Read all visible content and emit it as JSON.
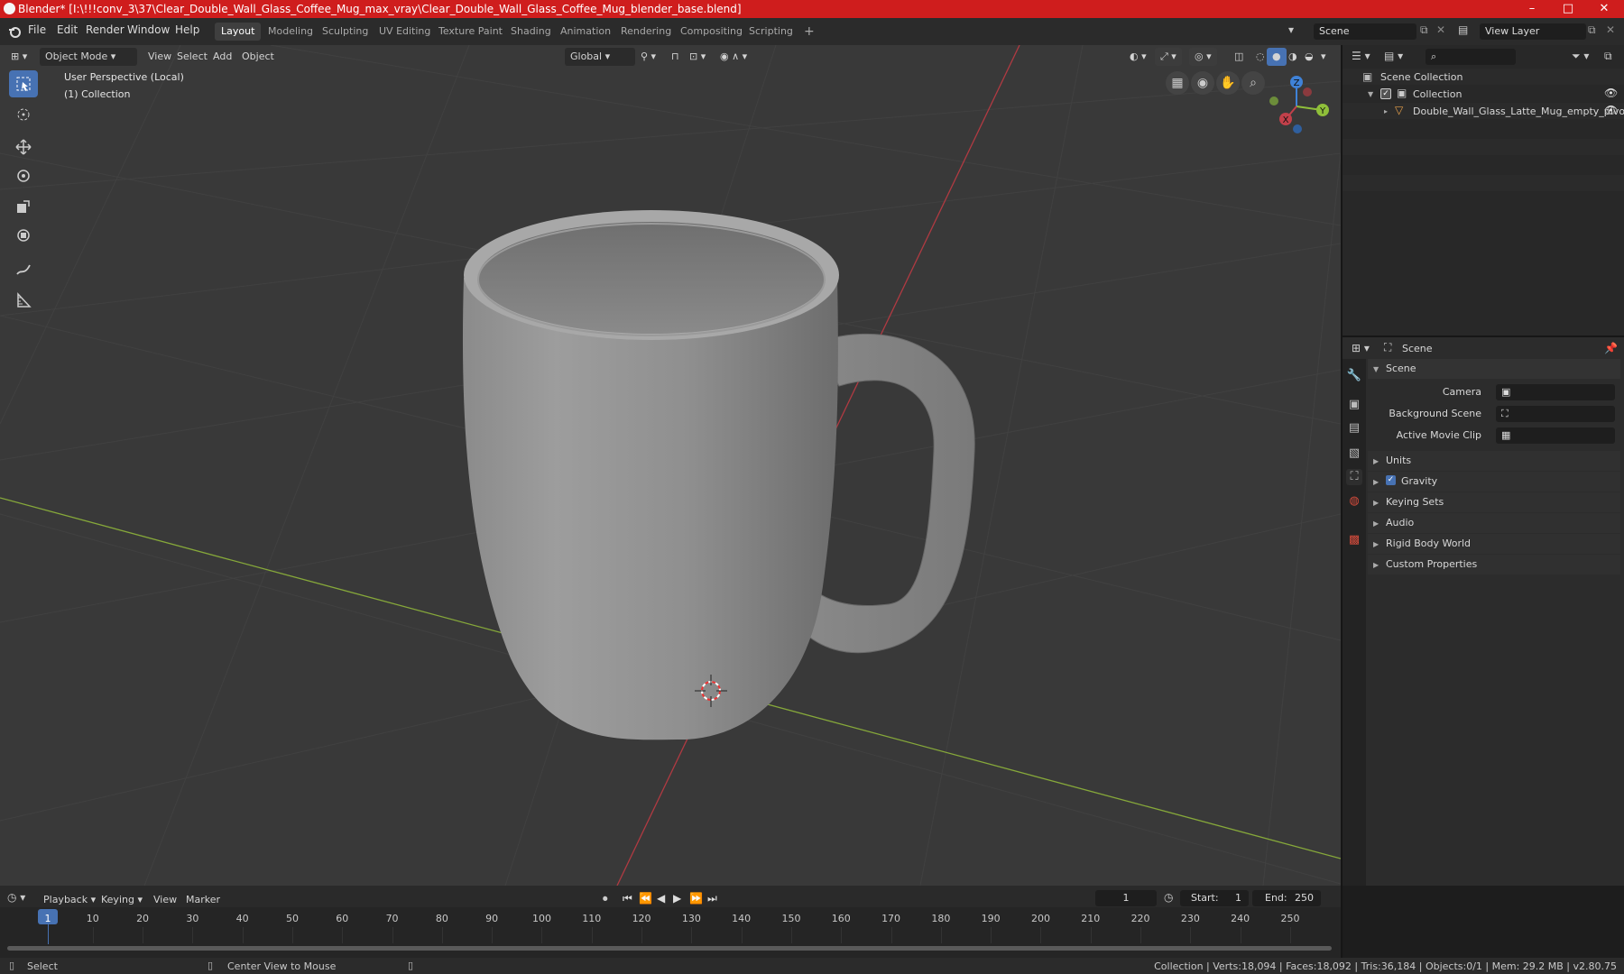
{
  "window": {
    "title": "Blender* [I:\\!!!conv_3\\37\\Clear_Double_Wall_Glass_Coffee_Mug_max_vray\\Clear_Double_Wall_Glass_Coffee_Mug_blender_base.blend]",
    "minimize": "–",
    "maximize": "□",
    "close": "✕"
  },
  "menu": [
    "File",
    "Edit",
    "Render",
    "Window",
    "Help"
  ],
  "workspaces": [
    "Layout",
    "Modeling",
    "Sculpting",
    "UV Editing",
    "Texture Paint",
    "Shading",
    "Animation",
    "Rendering",
    "Compositing",
    "Scripting"
  ],
  "workspace_add": "+",
  "scene_field": "Scene",
  "view_layer_field": "View Layer",
  "viewport_header": {
    "mode": "Object Mode",
    "menus": [
      "View",
      "Select",
      "Add",
      "Object"
    ],
    "orientation": "Global"
  },
  "viewport_overlay": {
    "perspective": "User Perspective (Local)",
    "collection": "(1) Collection"
  },
  "gizmo": {
    "z": "Z",
    "y": "Y",
    "x": "X"
  },
  "outliner": {
    "root": "Scene Collection",
    "collection": "Collection",
    "object": "Double_Wall_Glass_Latte_Mug_empty_pivot"
  },
  "properties": {
    "header": "Scene",
    "panel_title": "Scene",
    "camera_label": "Camera",
    "background_scene_label": "Background Scene",
    "active_movie_clip_label": "Active Movie Clip",
    "sections": [
      "Units",
      "Gravity",
      "Keying Sets",
      "Audio",
      "Rigid Body World",
      "Custom Properties"
    ]
  },
  "timeline": {
    "menus": [
      "Playback",
      "Keying",
      "View",
      "Marker"
    ],
    "current_frame": "1",
    "start_label": "Start:",
    "start_value": "1",
    "end_label": "End:",
    "end_value": "250",
    "ticks": [
      "1",
      "10",
      "20",
      "30",
      "40",
      "50",
      "60",
      "70",
      "80",
      "90",
      "100",
      "110",
      "120",
      "130",
      "140",
      "150",
      "160",
      "170",
      "180",
      "190",
      "200",
      "210",
      "220",
      "230",
      "240",
      "250"
    ]
  },
  "statusbar": {
    "select": "Select",
    "center_view": "Center View to Mouse",
    "stats": "Collection | Verts:18,094 | Faces:18,092 | Tris:36,184 | Objects:0/1 | Mem: 29.2 MB | v2.80.75"
  },
  "colors": {
    "title_bar": "#cf1d1d",
    "accent": "#4772b3",
    "axis_x": "#c2404a",
    "axis_y": "#8fbf3a",
    "axis_z": "#3f82d8"
  }
}
